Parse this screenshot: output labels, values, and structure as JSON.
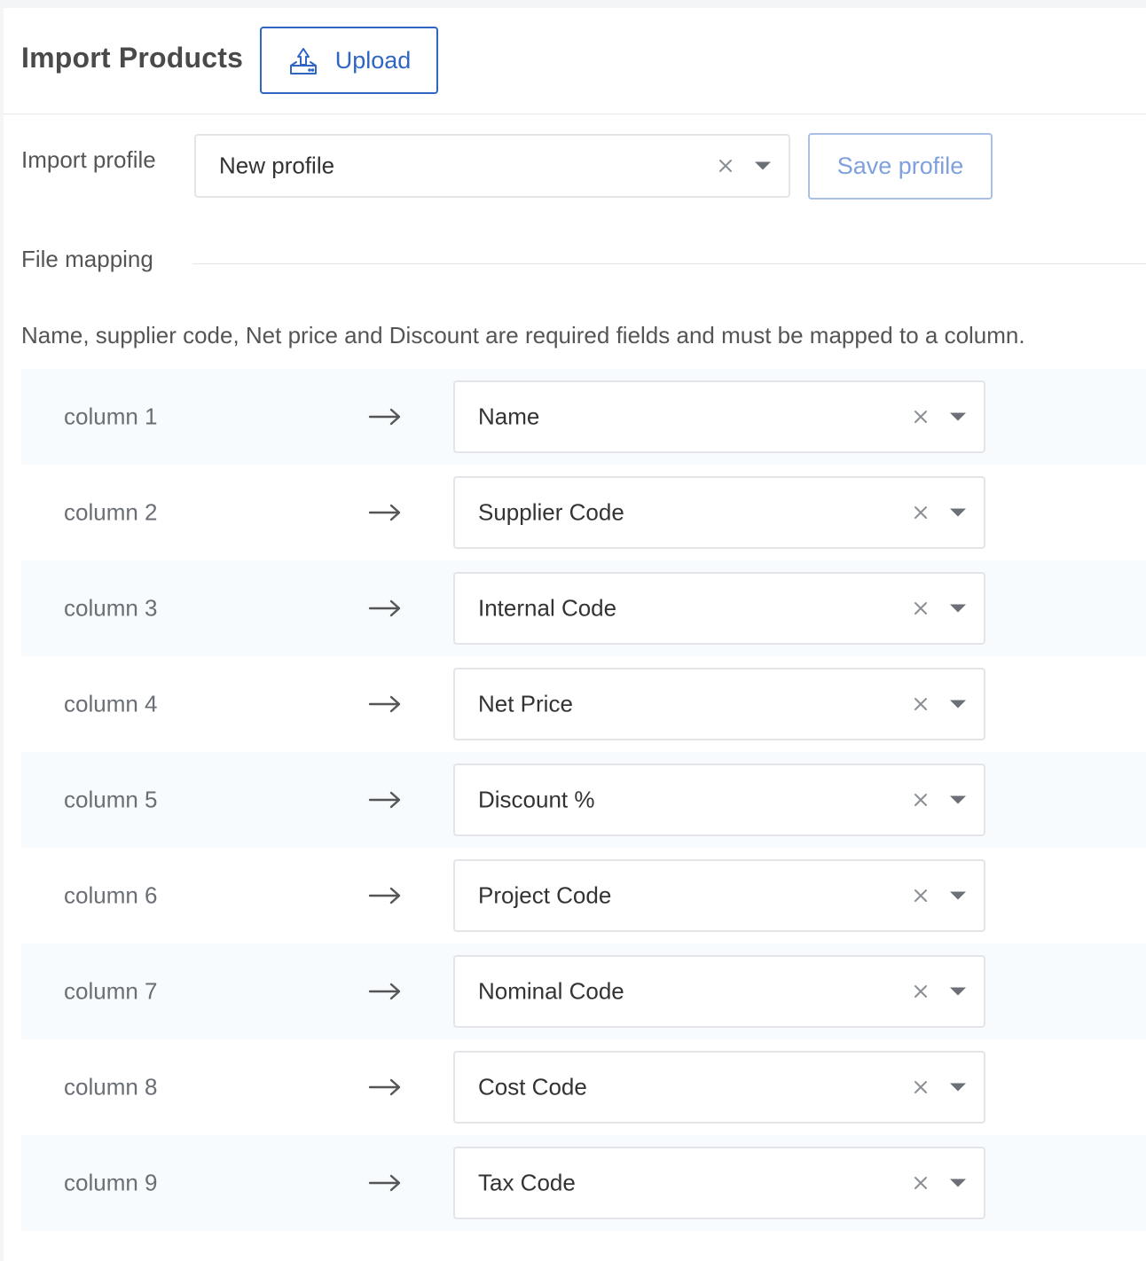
{
  "header": {
    "title": "Import Products",
    "upload_label": "Upload",
    "upload_icon": "upload-icon"
  },
  "profile": {
    "label": "Import profile",
    "selected": "New profile",
    "save_label": "Save profile"
  },
  "mapping": {
    "section_title": "File mapping",
    "notice": "Name, supplier code, Net price and Discount are required fields and must be mapped to a column.",
    "rows": [
      {
        "column": "column 1",
        "field": "Name"
      },
      {
        "column": "column 2",
        "field": "Supplier Code"
      },
      {
        "column": "column 3",
        "field": "Internal Code"
      },
      {
        "column": "column 4",
        "field": "Net Price"
      },
      {
        "column": "column 5",
        "field": "Discount %"
      },
      {
        "column": "column 6",
        "field": "Project Code"
      },
      {
        "column": "column 7",
        "field": "Nominal Code"
      },
      {
        "column": "column 8",
        "field": "Cost Code"
      },
      {
        "column": "column 9",
        "field": "Tax Code"
      }
    ]
  },
  "colors": {
    "accent": "#2f66c4",
    "accent_light": "#7fa0dd",
    "row_alt_bg": "#f7fbfe",
    "border": "#e3e5e9"
  }
}
